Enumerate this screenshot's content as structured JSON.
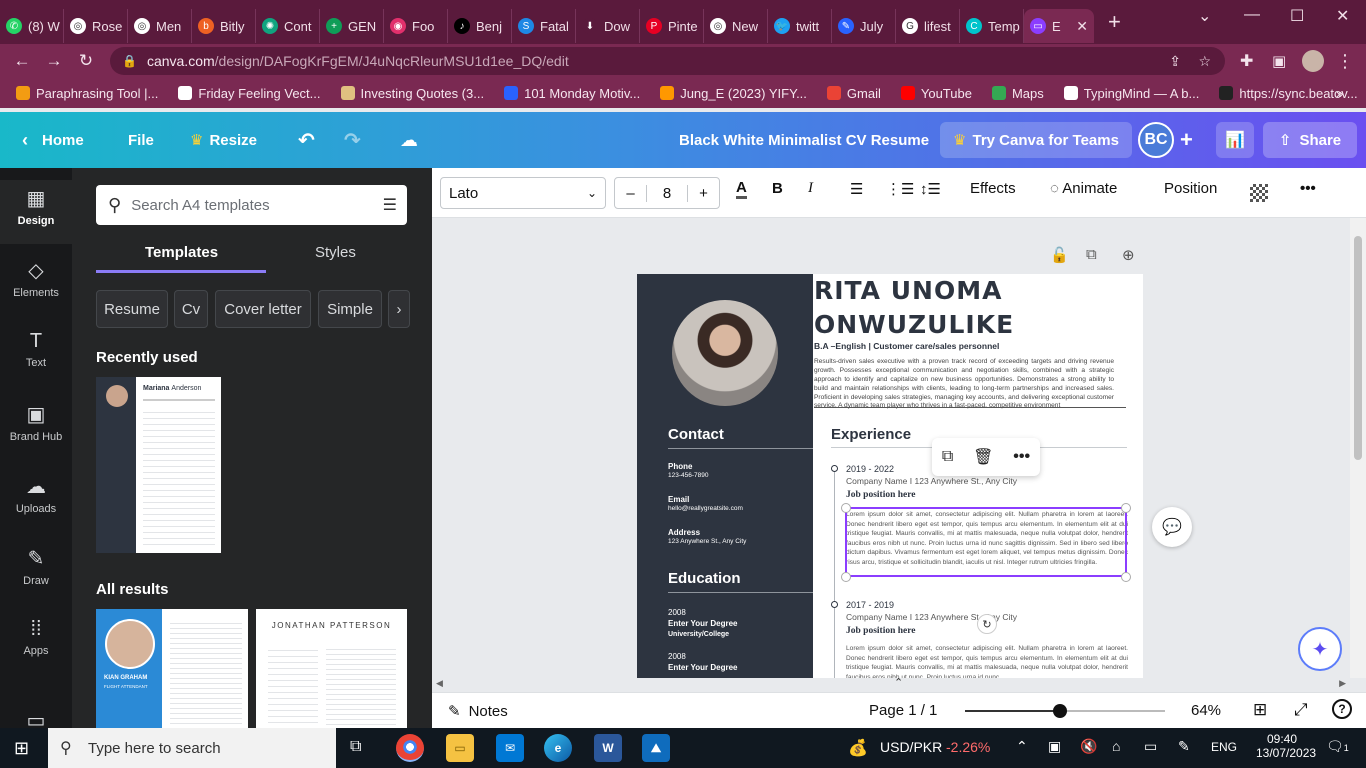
{
  "browser": {
    "tabs": [
      {
        "label": "(8) W",
        "color": "#25d366",
        "glyph": "✆"
      },
      {
        "label": "Rose",
        "color": "#ffffff",
        "glyph": "◎"
      },
      {
        "label": "Men",
        "color": "#ffffff",
        "glyph": "◎"
      },
      {
        "label": "Bitly",
        "color": "#ee6123",
        "glyph": "b"
      },
      {
        "label": "Cont",
        "color": "#10a37f",
        "glyph": "✺"
      },
      {
        "label": "GEN",
        "color": "#0f9d58",
        "glyph": "+"
      },
      {
        "label": "Foo",
        "color": "#e1306c",
        "glyph": "◉"
      },
      {
        "label": "Benj",
        "color": "#000000",
        "glyph": "♪"
      },
      {
        "label": "Fatal",
        "color": "#1e88e5",
        "glyph": "S"
      },
      {
        "label": "Dow",
        "color": "#5a1a3c",
        "glyph": "⬇"
      },
      {
        "label": "Pinte",
        "color": "#e60023",
        "glyph": "P"
      },
      {
        "label": "New",
        "color": "#ffffff",
        "glyph": "◎"
      },
      {
        "label": "twitt",
        "color": "#1da1f2",
        "glyph": "🐦"
      },
      {
        "label": "July",
        "color": "#2962ff",
        "glyph": "✎"
      },
      {
        "label": "lifest",
        "color": "#ffffff",
        "glyph": "G"
      },
      {
        "label": "Temp",
        "color": "#00c4cc",
        "glyph": "C"
      },
      {
        "label": "E",
        "color": "#8b3dff",
        "glyph": "▭"
      }
    ],
    "url_host": "canva.com",
    "url_path": "/design/DAFogKrFgEM/J4uNqcRleurMSU1d1ee_DQ/edit",
    "bookmarks": [
      {
        "label": "Paraphrasing Tool |...",
        "color": "#f39c12"
      },
      {
        "label": "Friday Feeling Vect...",
        "color": "#ffffff"
      },
      {
        "label": "Investing Quotes (3...",
        "color": "#e0c080"
      },
      {
        "label": "101 Monday Motiv...",
        "color": "#2962ff"
      },
      {
        "label": "Jung_E (2023) YIFY...",
        "color": "#ff9800"
      },
      {
        "label": "Gmail",
        "color": "#ea4335"
      },
      {
        "label": "YouTube",
        "color": "#ff0000"
      },
      {
        "label": "Maps",
        "color": "#34a853"
      },
      {
        "label": "TypingMind — A b...",
        "color": "#ffffff"
      },
      {
        "label": "https://sync.beatov...",
        "color": "#222222"
      }
    ]
  },
  "canva_header": {
    "home": "Home",
    "file": "File",
    "resize": "Resize",
    "doc_title": "Black White Minimalist CV Resume",
    "try_teams": "Try Canva for Teams",
    "avatar_initials": "BC",
    "share": "Share"
  },
  "rail": {
    "items": [
      {
        "label": "Design",
        "icon": "▦"
      },
      {
        "label": "Elements",
        "icon": "◇"
      },
      {
        "label": "Text",
        "icon": "T"
      },
      {
        "label": "Brand Hub",
        "icon": "▣"
      },
      {
        "label": "Uploads",
        "icon": "☁"
      },
      {
        "label": "Draw",
        "icon": "✎"
      },
      {
        "label": "Apps",
        "icon": "⁞⁞"
      }
    ]
  },
  "panel": {
    "search_placeholder": "Search A4 templates",
    "tab_templates": "Templates",
    "tab_styles": "Styles",
    "chips": [
      "Resume",
      "Cv",
      "Cover letter",
      "Simple"
    ],
    "recently_used": "Recently used",
    "all_results": "All results",
    "recent_thumb_name_first": "Mariana",
    "recent_thumb_name_last": "Anderson",
    "result1_name": "KIAN GRAHAM",
    "result1_role": "FLIGHT ATTENDANT",
    "result2_name": "JONATHAN PATTERSON"
  },
  "toolbar": {
    "font": "Lato",
    "size": "8",
    "effects": "Effects",
    "animate": "Animate",
    "position": "Position"
  },
  "resume": {
    "name_line1": "RITA UNOMA",
    "name_line2": "ONWUZULIKE",
    "subtitle": "B.A –English | Customer care/sales personnel",
    "summary": "Results-driven sales executive with a proven track record of exceeding targets and driving revenue growth. Possesses exceptional communication and negotiation skills, combined with a strategic approach to identify and capitalize on new business opportunities. Demonstrates a strong ability to build and maintain relationships with clients, leading to long-term partnerships and increased sales. Proficient in developing sales strategies, managing key accounts, and delivering exceptional customer service. A dynamic team player who thrives in a fast-paced, competitive environment",
    "contact_title": "Contact",
    "phone_label": "Phone",
    "phone": "123-456-7890",
    "email_label": "Email",
    "email": "hello@reallygreatsite.com",
    "address_label": "Address",
    "address": "123 Anywhere St., Any City",
    "education_title": "Education",
    "edu1_year": "2008",
    "edu1_degree": "Enter Your Degree",
    "edu1_school": "University/College",
    "edu2_year": "2008",
    "edu2_degree": "Enter Your Degree",
    "experience_title": "Experience",
    "exp1_years": "2019 - 2022",
    "exp1_company": "Company Name I 123 Anywhere St., Any City",
    "exp1_position": "Job position here",
    "exp1_text": "Lorem ipsum dolor sit amet, consectetur adipiscing elit. Nullam pharetra in lorem at laoreet. Donec hendrerit libero eget est tempor, quis tempus arcu elementum. In elementum elit at dui tristique feugiat. Mauris convallis, mi at mattis malesuada, neque nulla volutpat dolor, hendrerit faucibus eros nibh ut nunc. Proin luctus urna id nunc sagittis dignissim. Sed in libero sed libero dictum dapibus. Vivamus fermentum est eget lorem aliquet, vel tempus metus dignissim. Donec risus arcu, tristique et sollicitudin blandit, iaculis ut nisl. Integer rutrum ultricies fringilla.",
    "exp2_years": "2017 - 2019",
    "exp2_company": "Company Name I 123 Anywhere St., Any City",
    "exp2_position": "Job position here",
    "exp2_text": "Lorem ipsum dolor sit amet, consectetur adipiscing elit. Nullam pharetra in lorem at laoreet. Donec hendrerit libero eget est tempor, quis tempus arcu elementum. In elementum elit at dui tristique feugiat. Mauris convallis, mi at mattis malesuada, neque nulla volutpat dolor, hendrerit faucibus eros nibh ut nunc. Proin luctus urna id nunc"
  },
  "bottom": {
    "notes": "Notes",
    "page": "Page 1 / 1",
    "zoom": "64%",
    "zoom_level": 0.64
  },
  "taskbar": {
    "search_placeholder": "Type here to search",
    "ticker_name": "USD/PKR",
    "ticker_change": "-2.26%",
    "lang": "ENG",
    "time": "09:40",
    "date": "13/07/2023",
    "notif_count": "1"
  }
}
